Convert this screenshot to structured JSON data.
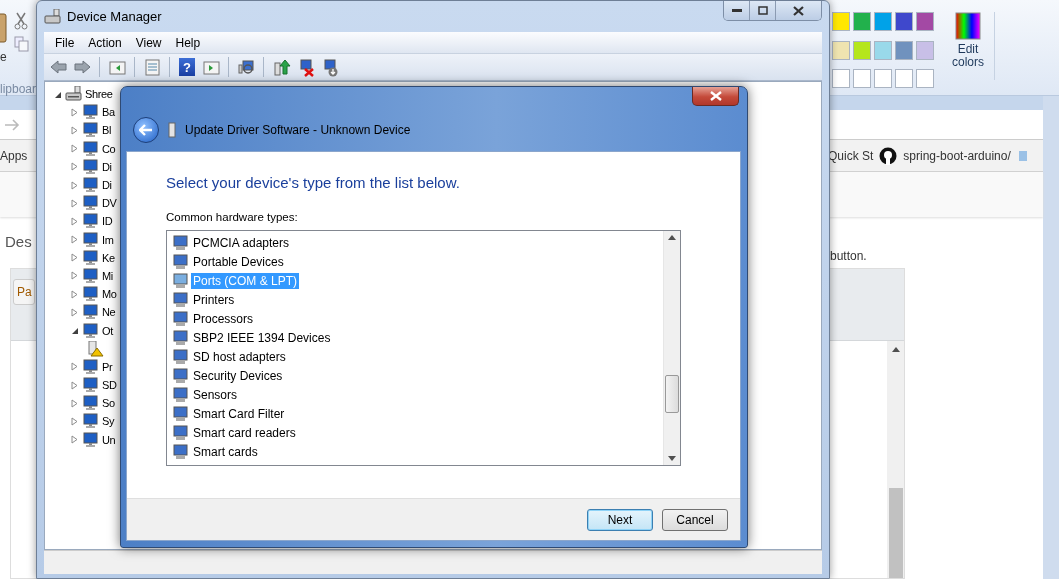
{
  "paint": {
    "paste_label": "e",
    "group_label": "lipboar",
    "edit_colors": "Edit colors",
    "palette": [
      {
        "color": "#ffe700"
      },
      {
        "color": "#22b14c"
      },
      {
        "color": "#00a2e8"
      },
      {
        "color": "#3f48cc"
      },
      {
        "color": "#a349a4"
      },
      {
        "color": "#efe4b0"
      },
      {
        "color": "#b5e61d"
      },
      {
        "color": "#99d9ea"
      },
      {
        "color": "#7092be"
      },
      {
        "color": "#c8bfe7"
      },
      {
        "color": "#ffffff"
      },
      {
        "color": "#ffffff"
      },
      {
        "color": "#ffffff"
      },
      {
        "color": "#ffffff"
      },
      {
        "color": "#ffffff"
      }
    ]
  },
  "browser": {
    "apps": "Apps",
    "bookmarks": [
      "Quick St",
      "spring-boot-arduino/"
    ],
    "page_text_left": "Des",
    "page_text_right": "button.",
    "tab": "Pa"
  },
  "device_manager": {
    "title": "Device Manager",
    "menu": [
      "File",
      "Action",
      "View",
      "Help"
    ],
    "toolbar": [
      {
        "kind": "back"
      },
      {
        "kind": "forward"
      },
      {
        "kind": "sep"
      },
      {
        "kind": "pane"
      },
      {
        "kind": "sep"
      },
      {
        "kind": "list"
      },
      {
        "kind": "sep"
      },
      {
        "kind": "help",
        "glyph": "?"
      },
      {
        "kind": "pane2"
      },
      {
        "kind": "sep"
      },
      {
        "kind": "scan"
      },
      {
        "kind": "sep"
      },
      {
        "kind": "update"
      },
      {
        "kind": "uninstall"
      },
      {
        "kind": "disable"
      }
    ],
    "tree": {
      "label": "Shree",
      "kind": "computer",
      "expanded": true,
      "children": [
        {
          "label": "Ba",
          "kind": "device",
          "expanded": false
        },
        {
          "label": "Bl",
          "kind": "device",
          "expanded": false
        },
        {
          "label": "Co",
          "kind": "device",
          "expanded": false
        },
        {
          "label": "Di",
          "kind": "device",
          "expanded": false
        },
        {
          "label": "Di",
          "kind": "device",
          "expanded": false
        },
        {
          "label": "DV",
          "kind": "device",
          "expanded": false
        },
        {
          "label": "ID",
          "kind": "device",
          "expanded": false
        },
        {
          "label": "Im",
          "kind": "device",
          "expanded": false
        },
        {
          "label": "Ke",
          "kind": "device",
          "expanded": false
        },
        {
          "label": "Mi",
          "kind": "device",
          "expanded": false
        },
        {
          "label": "Mo",
          "kind": "device",
          "expanded": false
        },
        {
          "label": "Ne",
          "kind": "device",
          "expanded": false
        },
        {
          "label": "Ot",
          "kind": "device",
          "expanded": true,
          "children": [
            {
              "kind": "warning"
            }
          ]
        },
        {
          "label": "Pr",
          "kind": "device",
          "expanded": false
        },
        {
          "label": "SD",
          "kind": "device",
          "expanded": false
        },
        {
          "label": "So",
          "kind": "device",
          "expanded": false
        },
        {
          "label": "Sy",
          "kind": "device",
          "expanded": false
        },
        {
          "label": "Un",
          "kind": "device",
          "expanded": false
        }
      ]
    }
  },
  "update_dialog": {
    "title": "Update Driver Software - Unknown Device",
    "heading": "Select your device's type from the list below.",
    "list_label": "Common hardware types:",
    "hardware_types": [
      {
        "label": "PCMCIA adapters",
        "selected": false
      },
      {
        "label": "Portable Devices",
        "selected": false
      },
      {
        "label": "Ports (COM & LPT)",
        "selected": true
      },
      {
        "label": "Printers",
        "selected": false
      },
      {
        "label": "Processors",
        "selected": false
      },
      {
        "label": "SBP2 IEEE 1394 Devices",
        "selected": false
      },
      {
        "label": "SD host adapters",
        "selected": false
      },
      {
        "label": "Security Devices",
        "selected": false
      },
      {
        "label": "Sensors",
        "selected": false
      },
      {
        "label": "Smart Card Filter",
        "selected": false
      },
      {
        "label": "Smart card readers",
        "selected": false
      },
      {
        "label": "Smart cards",
        "selected": false
      }
    ],
    "buttons": [
      {
        "label": "Next",
        "default": true
      },
      {
        "label": "Cancel",
        "default": false
      }
    ]
  }
}
